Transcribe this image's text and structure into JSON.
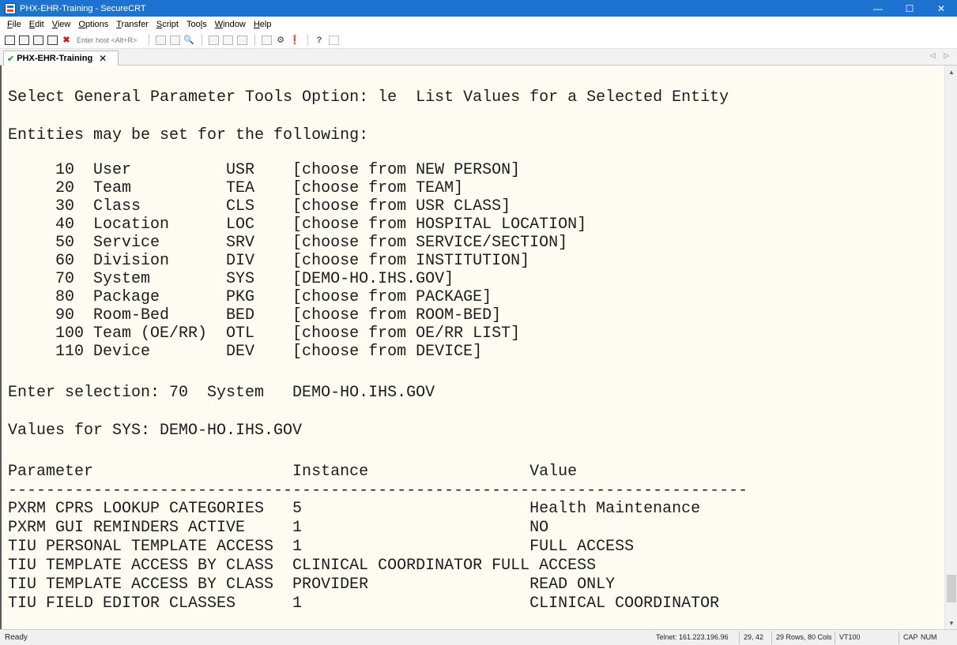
{
  "window": {
    "title": "PHX-EHR-Training - SecureCRT",
    "min": "—",
    "max": "☐",
    "close": "✕"
  },
  "menu": [
    {
      "pre": "",
      "key": "F",
      "post": "ile"
    },
    {
      "pre": "",
      "key": "E",
      "post": "dit"
    },
    {
      "pre": "",
      "key": "V",
      "post": "iew"
    },
    {
      "pre": "",
      "key": "O",
      "post": "ptions"
    },
    {
      "pre": "",
      "key": "T",
      "post": "ransfer"
    },
    {
      "pre": "",
      "key": "S",
      "post": "cript"
    },
    {
      "pre": "Too",
      "key": "l",
      "post": "s"
    },
    {
      "pre": "",
      "key": "W",
      "post": "indow"
    },
    {
      "pre": "",
      "key": "H",
      "post": "elp"
    }
  ],
  "toolbar": {
    "host_placeholder": "Enter host <Alt+R>"
  },
  "tab": {
    "label": "PHX-EHR-Training",
    "close": "✕",
    "nav": "◁ ▷"
  },
  "terminal": {
    "lines": [
      "Select General Parameter Tools Option: le  List Values for a Selected Entity",
      "",
      "Entities may be set for the following:",
      "",
      "     10  User          USR    [choose from NEW PERSON]",
      "     20  Team          TEA    [choose from TEAM]",
      "     30  Class         CLS    [choose from USR CLASS]",
      "     40  Location      LOC    [choose from HOSPITAL LOCATION]",
      "     50  Service       SRV    [choose from SERVICE/SECTION]",
      "     60  Division      DIV    [choose from INSTITUTION]",
      "     70  System        SYS    [DEMO-HO.IHS.GOV]",
      "     80  Package       PKG    [choose from PACKAGE]",
      "     90  Room-Bed      BED    [choose from ROOM-BED]",
      "     100 Team (OE/RR)  OTL    [choose from OE/RR LIST]",
      "     110 Device        DEV    [choose from DEVICE]",
      "",
      "Enter selection: 70  System   DEMO-HO.IHS.GOV",
      "",
      "Values for SYS: DEMO-HO.IHS.GOV",
      "",
      "Parameter                     Instance                 Value",
      "------------------------------------------------------------------------------",
      "PXRM CPRS LOOKUP CATEGORIES   5                        Health Maintenance",
      "PXRM GUI REMINDERS ACTIVE     1                        NO",
      "TIU PERSONAL TEMPLATE ACCESS  1                        FULL ACCESS",
      "TIU TEMPLATE ACCESS BY CLASS  CLINICAL COORDINATOR FULL ACCESS",
      "TIU TEMPLATE ACCESS BY CLASS  PROVIDER                 READ ONLY",
      "TIU FIELD EDITOR CLASSES      1                        CLINICAL COORDINATOR"
    ]
  },
  "status": {
    "ready": "Ready",
    "connection": "Telnet: 161.223.196.96",
    "cursor": "29, 42",
    "size": "29 Rows, 80 Cols",
    "emulation": "VT100",
    "cap": "CAP",
    "num": "NUM"
  }
}
